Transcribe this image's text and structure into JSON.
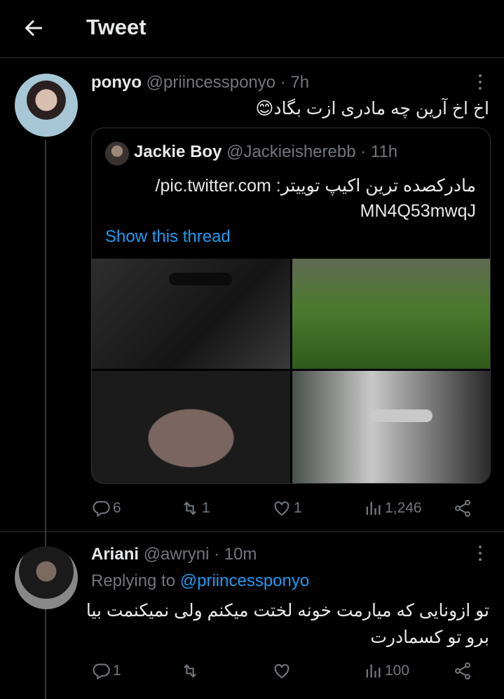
{
  "header": {
    "title": "Tweet"
  },
  "tweet": {
    "author_name": "ponyo",
    "author_meta": "@priincessponyo · 7h",
    "text": "اخ اخ آرین چه مادری ازت بگاد😊",
    "quote": {
      "author_name": "Jackie Boy",
      "author_meta": "@Jackieisherebb · 11h",
      "text_line1": "مادرکصده ترین اکیپ توییتر: pic.twitter.com/",
      "text_line2": "MN4Q53mwqJ",
      "thread_link": "Show this thread"
    },
    "stats": {
      "replies": "6",
      "retweets": "1",
      "likes": "1",
      "views": "1,246"
    }
  },
  "reply": {
    "author_name": "Ariani",
    "author_meta": "@awryni · 10m",
    "replying_prefix": "Replying to",
    "replying_handle": "@priincessponyo",
    "text_line1": "تو ازونایی که میارمت خونه لختت میکنم ولی نمیکنمت بیا",
    "text_line2": "برو تو کسمادرت",
    "stats": {
      "replies": "1",
      "retweets": "",
      "likes": "",
      "views": "100"
    }
  },
  "icons": [
    "back-arrow-icon",
    "more-icon",
    "reply-icon",
    "retweet-icon",
    "like-icon",
    "views-icon",
    "share-icon"
  ]
}
